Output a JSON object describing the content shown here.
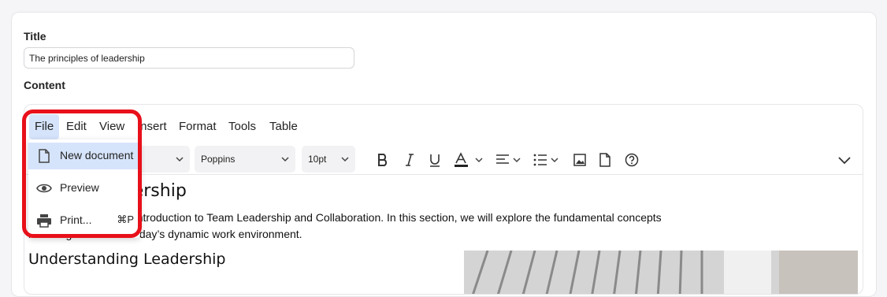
{
  "form": {
    "title_label": "Title",
    "title_value": "The principles of leadership",
    "content_label": "Content"
  },
  "menubar": {
    "items": [
      {
        "label": "File"
      },
      {
        "label": "Edit"
      },
      {
        "label": "View"
      },
      {
        "label": "Insert"
      },
      {
        "label": "Format"
      },
      {
        "label": "Tools"
      },
      {
        "label": "Table"
      }
    ],
    "active": "File"
  },
  "toolbar": {
    "block_select": "",
    "font_family": "Poppins",
    "font_size": "10pt",
    "icons": [
      "bold-icon",
      "italic-icon",
      "underline-icon",
      "text-color-icon",
      "align-icon",
      "list-icon",
      "image-icon",
      "document-icon",
      "help-icon",
      "more-chevron-icon"
    ]
  },
  "file_menu": {
    "items": [
      {
        "label": "New document",
        "icon": "new-document-icon",
        "shortcut": ""
      },
      {
        "label": "Preview",
        "icon": "eye-icon",
        "shortcut": ""
      },
      {
        "label": "Print...",
        "icon": "printer-icon",
        "shortcut": "⌘P"
      }
    ]
  },
  "document": {
    "heading1_visible": "f Team Leadership",
    "para_line1": "ection of the module, Introduction to Team Leadership and Collaboration. In this section, we will explore the fundamental concepts",
    "para_line2": "nd its significance in today’s dynamic work environment.",
    "heading2": "Understanding Leadership"
  },
  "colors": {
    "highlight": "#d6e4fb",
    "annotation_red": "#e8101a",
    "text_color_bar": "#222222"
  }
}
